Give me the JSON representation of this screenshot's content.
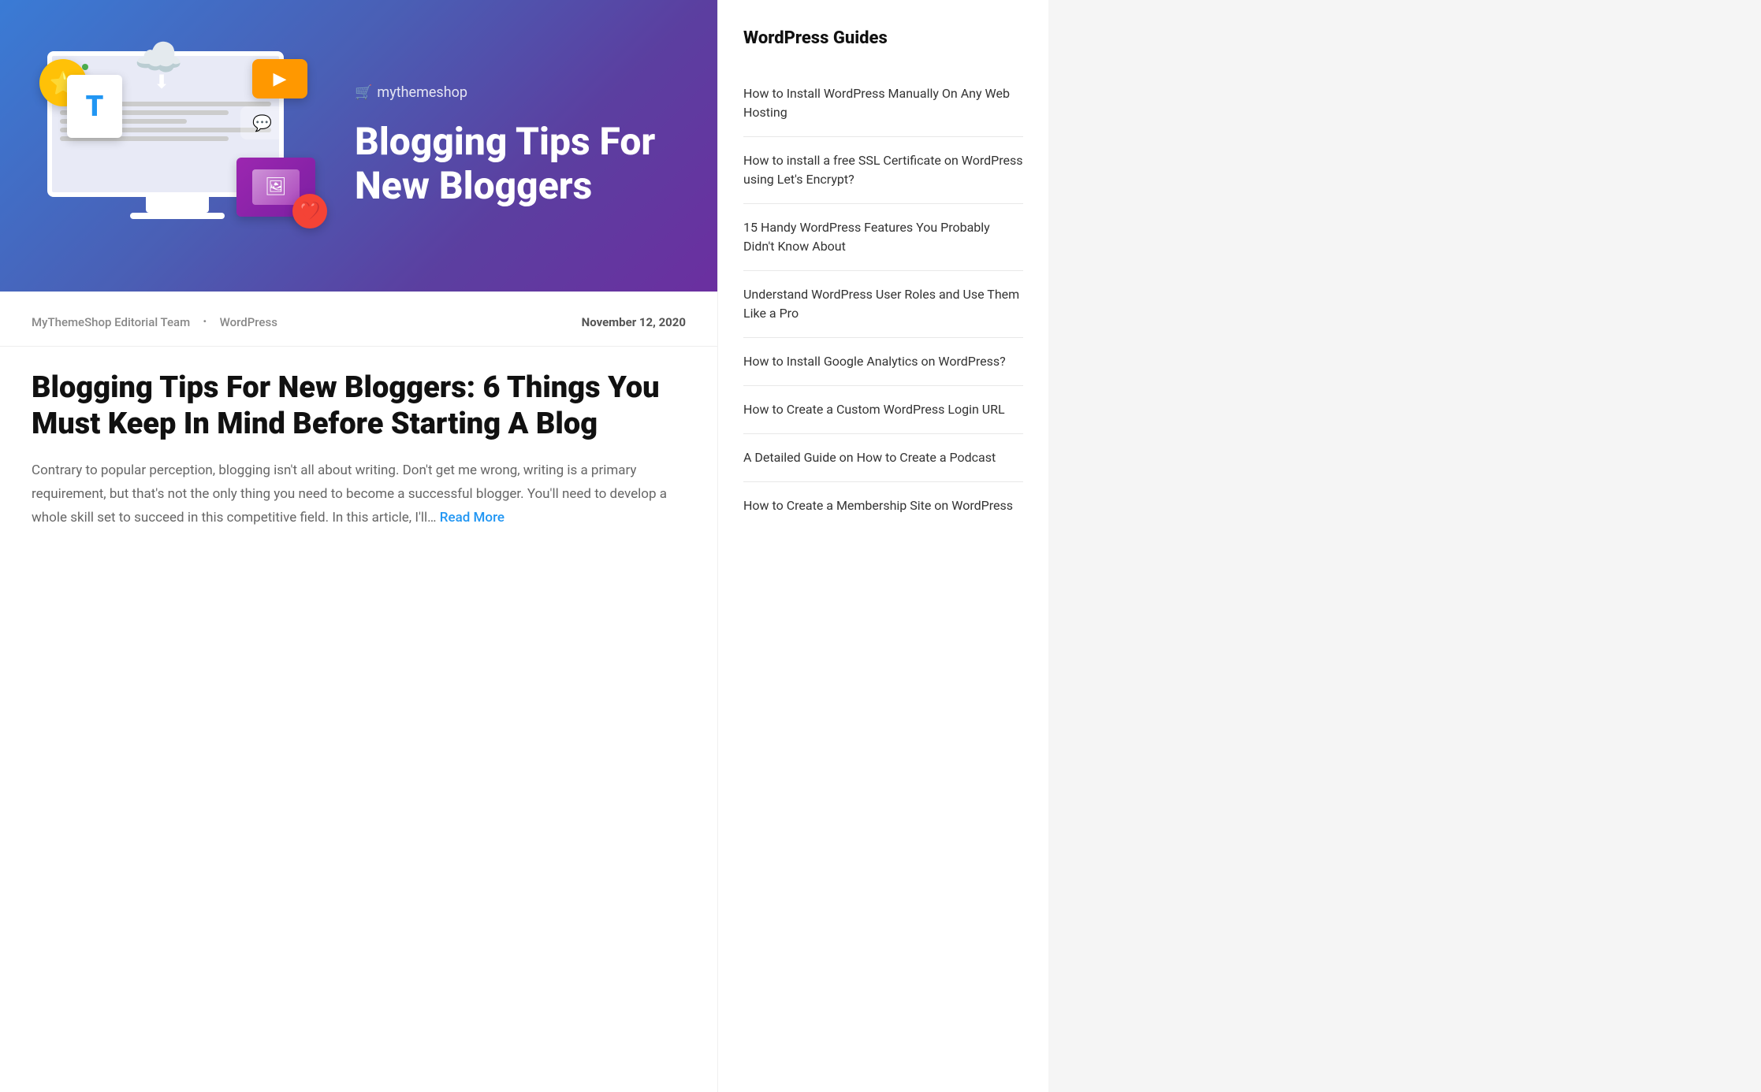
{
  "hero": {
    "logo_text": "mythemeshop",
    "logo_icon": "🛒",
    "title_line1": "Blogging Tips For",
    "title_line2": "New Bloggers"
  },
  "article": {
    "author": "MyThemeShop Editorial Team",
    "dot": "·",
    "category": "WordPress",
    "date": "November 12, 2020",
    "title": "Blogging Tips For New Bloggers: 6 Things You Must Keep In Mind Before Starting A Blog",
    "excerpt": "Contrary to popular perception, blogging isn't all about writing. Don't get me wrong, writing is a primary requirement, but that's not the only thing you need to become a successful blogger. You'll need to develop a whole skill set to succeed in this competitive field. In this article, I'll…",
    "read_more": "Read More"
  },
  "sidebar": {
    "title": "WordPress Guides",
    "links": [
      {
        "label": "How to Install WordPress Manually On Any Web Hosting"
      },
      {
        "label": "How to install a free SSL Certificate on WordPress using Let's Encrypt?"
      },
      {
        "label": "15 Handy WordPress Features You Probably Didn't Know About"
      },
      {
        "label": "Understand WordPress User Roles and Use Them Like a Pro"
      },
      {
        "label": "How to Install Google Analytics on WordPress?"
      },
      {
        "label": "How to Create a Custom WordPress Login URL"
      },
      {
        "label": "A Detailed Guide on How to Create a Podcast"
      },
      {
        "label": "How to Create a Membership Site on WordPress"
      }
    ]
  },
  "icons": {
    "star": "⭐",
    "play": "▶",
    "heart": "❤",
    "chat": "💬",
    "cloud": "☁",
    "arrow_down": "↓",
    "image": "🖼"
  }
}
